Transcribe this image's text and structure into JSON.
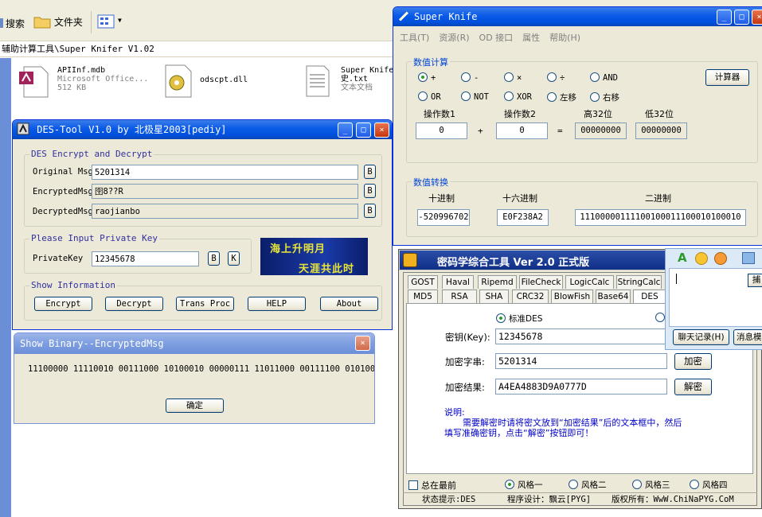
{
  "explorer": {
    "toolbar": {
      "search": "搜索",
      "folders": "文件夹"
    },
    "address": "辅助计算工具\\Super Knifer V1.02",
    "files": [
      {
        "name": "APIInf.mdb",
        "type": "Microsoft Office...",
        "size": "512 KB"
      },
      {
        "name": "odscpt.dll"
      },
      {
        "name": "Super Knife",
        "name2": "史.txt",
        "type": "文本文档"
      }
    ]
  },
  "super_knife": {
    "title": "Super Knife",
    "menu": [
      "工具(T)",
      "资源(R)",
      "OD 接口",
      "属性",
      "帮助(H)"
    ],
    "calc_group": "数值计算",
    "ops_row1": [
      "+",
      "-",
      "×",
      "÷",
      "AND"
    ],
    "ops_row2": [
      "OR",
      "NOT",
      "XOR",
      "左移",
      "右移"
    ],
    "calculator_button": "计算器",
    "labels": {
      "op1": "操作数1",
      "op2": "操作数2",
      "high": "高32位",
      "low": "低32位"
    },
    "plus": "+",
    "equals": "=",
    "values": {
      "op1": "0",
      "op2": "0",
      "high": "00000000",
      "low": "00000000"
    },
    "convert_group": "数值转换",
    "convert_labels": {
      "dec": "十进制",
      "hex": "十六进制",
      "bin": "二进制"
    },
    "convert_values": {
      "dec": "-520996702",
      "hex": "E0F238A2",
      "bin": "11100000111100100011100010100010"
    }
  },
  "des_tool": {
    "title": "DES-Tool V1.0 by 北极星2003[pediy]",
    "group1": "DES Encrypt and Decrypt",
    "original_label": "Original Msg",
    "original_value": "5201314",
    "encrypted_label": "EncryptedMsg",
    "encrypted_value": "囹8??R",
    "decrypted_label": "DecryptedMsg",
    "decrypted_value": "raojianbo",
    "b_label": "B",
    "k_label": "K",
    "key_group": "Please Input Private Key",
    "key_label": "PrivateKey",
    "key_value": "12345678",
    "banner_line1": "海上升明月",
    "banner_line2": "天涯共此时",
    "info_group": "Show Information",
    "buttons": [
      "Encrypt",
      "Decrypt",
      "Trans Proc",
      "HELP",
      "About"
    ]
  },
  "binary_dialog": {
    "title": "Show Binary--EncryptedMsg",
    "binary": "11100000 11110010 00111000 10100010 00000111 11011000 00111100 01010010",
    "ok": "确定"
  },
  "crypto_tool": {
    "title": "密码学综合工具 Ver 2.0 正式版",
    "tabs_row1": [
      "GOST",
      "Haval",
      "Ripemd",
      "FileCheck",
      "LogicCalc",
      "StringCalc"
    ],
    "tabs_row2": [
      "MD5",
      "RSA",
      "SHA",
      "CRC32",
      "BlowFish",
      "Base64",
      "DES"
    ],
    "mode_standard": "标准DES",
    "key_label": "密钥(Key):",
    "key_value": "12345678",
    "plain_label": "加密字串:",
    "plain_value": "5201314",
    "result_label": "加密结果:",
    "result_value": "A4EA4883D9A0777D",
    "encrypt_button": "加密",
    "decrypt_button": "解密",
    "note_title": "说明:",
    "note_line1": "需要解密时请将密文放到“加密结果”后的文本框中，然后",
    "note_line2": "填写准确密钥，点击“解密”按钮即可！",
    "topmost": "总在最前",
    "styles": [
      "风格一",
      "风格二",
      "风格三",
      "风格四"
    ],
    "status": "状态提示:DES",
    "designer": "程序设计：飘云[PYG]",
    "copyright": "版权所有：WwW.ChiNaPYG.CoM"
  },
  "chat_panel": {
    "history": "聊天记录(H)",
    "message": "消息模",
    "capture": "捕"
  }
}
